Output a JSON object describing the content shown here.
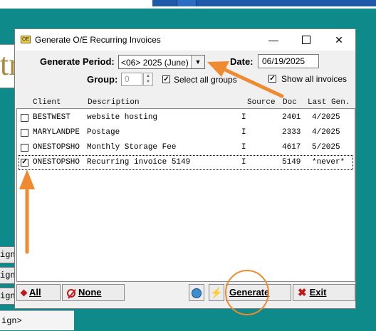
{
  "dialog": {
    "title": "Generate O/E Recurring Invoices",
    "icon_label": "OE",
    "window_controls": {
      "minimize": "—",
      "close": "✕"
    }
  },
  "form": {
    "period_label": "Generate Period:",
    "period_value": "<06> 2025 (June)",
    "date_label": "Date:",
    "date_value": "06/19/2025",
    "group_label": "Group:",
    "group_value": "0",
    "select_all_groups_label": "Select all groups",
    "select_all_groups_checked": true,
    "show_all_invoices_label": "Show all invoices",
    "show_all_invoices_checked": true
  },
  "table": {
    "headers": [
      "Client",
      "Description",
      "Source",
      "Doc",
      "Last Gen."
    ],
    "rows": [
      {
        "checked": false,
        "check_mark": "",
        "client": "BESTWEST",
        "description": "website hosting",
        "source": "I",
        "doc": "2401",
        "last_gen": "4/2025"
      },
      {
        "checked": false,
        "check_mark": "",
        "client": "MARYLANDPE",
        "description": "Postage",
        "source": "I",
        "doc": "2333",
        "last_gen": "4/2025"
      },
      {
        "checked": false,
        "check_mark": "",
        "client": "ONESTOPSHO",
        "description": "Monthly Storage Fee",
        "source": "I",
        "doc": "4617",
        "last_gen": "5/2025"
      },
      {
        "checked": true,
        "check_mark": "✓",
        "client": "ONESTOPSHO",
        "description": "Recurring invoice 5149",
        "source": "I",
        "doc": "5149",
        "last_gen": "*never*"
      }
    ]
  },
  "buttons": {
    "all": "All",
    "none": "None",
    "generate": "Generate",
    "exit": "Exit"
  },
  "background": {
    "frag_text": "tr",
    "side_buttons": [
      "ign",
      "ign",
      "ign"
    ],
    "bottom_text": "ign>"
  },
  "colors": {
    "teal_background": "#0f8a8a",
    "annotation_orange": "#f08a30",
    "icon_red": "#c01818"
  }
}
